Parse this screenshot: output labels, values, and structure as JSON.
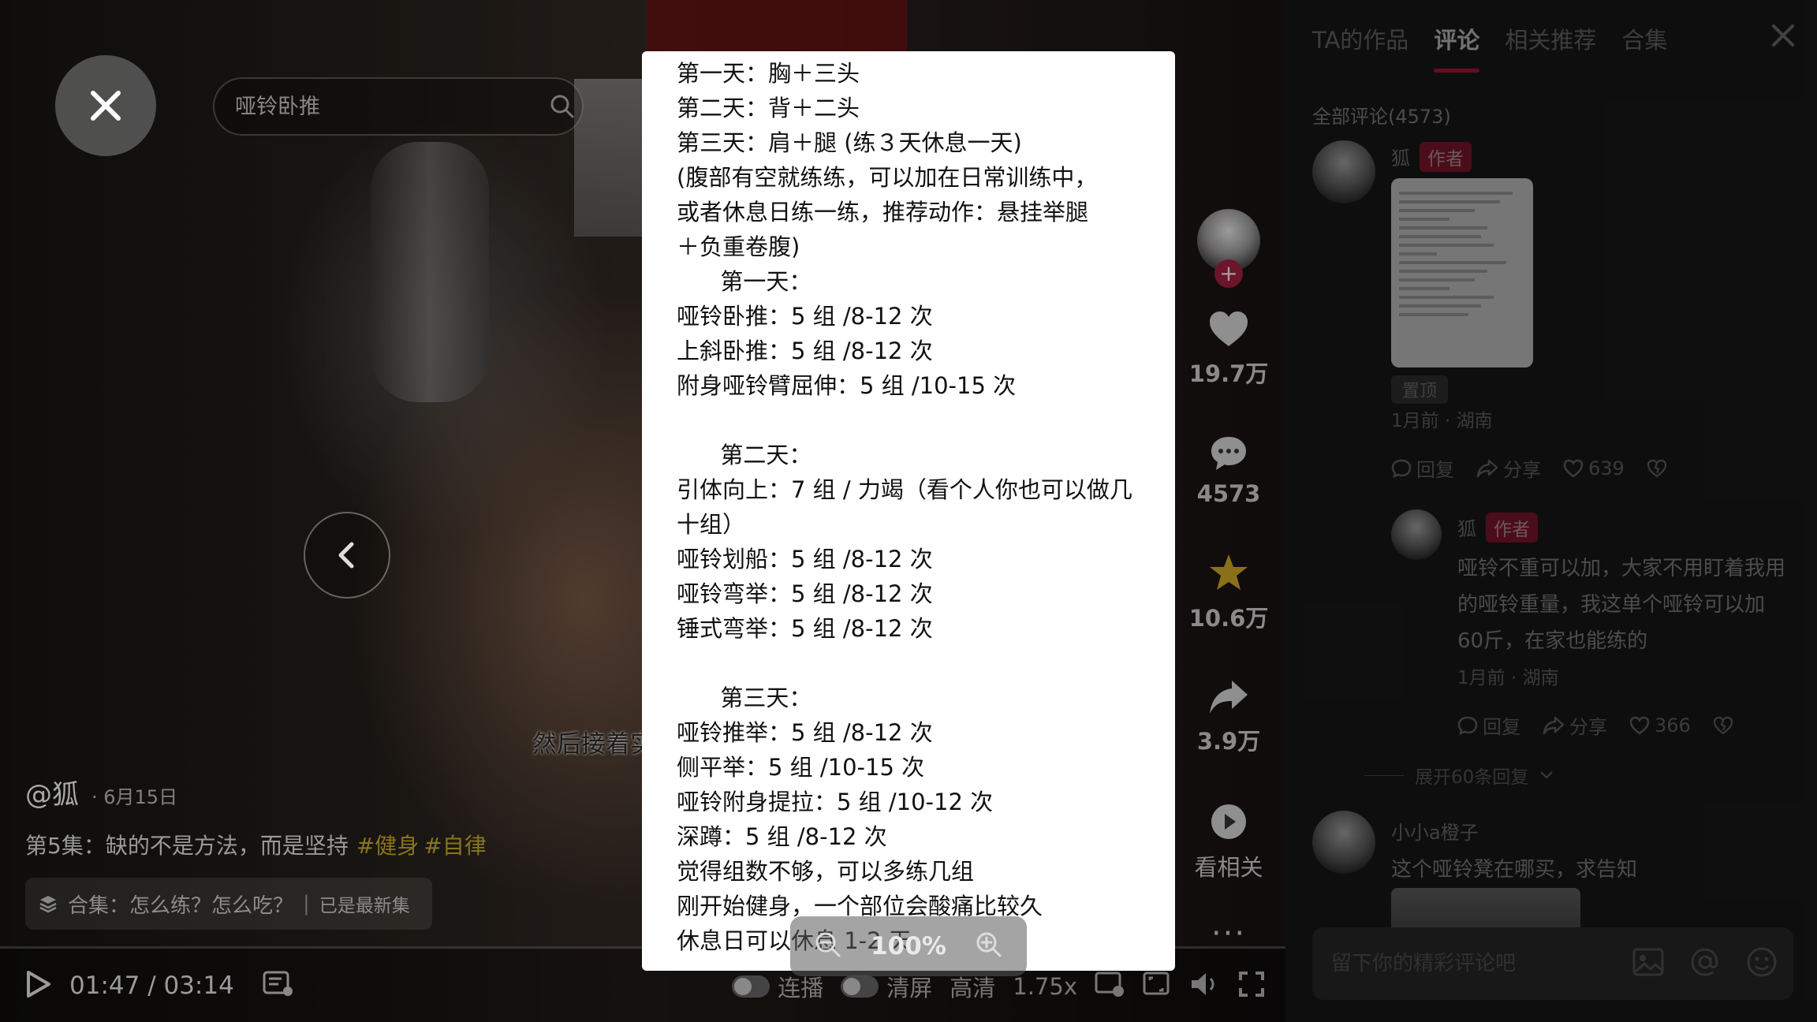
{
  "search": {
    "placeholder": "哑铃卧推"
  },
  "video": {
    "subtitle": "然后接着实",
    "author": "@狐",
    "date": "6月15日",
    "caption": "第5集：缺的不是方法，而是坚持",
    "tags": [
      "#健身",
      "#自律"
    ],
    "collection_label": "合集：怎么练？怎么吃？",
    "collection_status": "已是最新集"
  },
  "actions": {
    "likes": "19.7万",
    "comments": "4573",
    "favorites": "10.6万",
    "shares": "3.9万",
    "related": "看相关",
    "more": "···"
  },
  "player": {
    "time": "01:47 / 03:14",
    "autoplay_label": "连播",
    "clear_label": "清屏",
    "quality": "高清",
    "speed": "1.75x"
  },
  "panel": {
    "tabs": [
      "TA的作品",
      "评论",
      "相关推荐",
      "合集"
    ],
    "comment_count": "全部评论(4573)",
    "comments": [
      {
        "name": "狐",
        "author_tag": "作者",
        "pin": "置顶",
        "meta": "1月前 · 湖南",
        "reply": "回复",
        "share": "分享",
        "likes": "639"
      },
      {
        "name": "狐",
        "author_tag": "作者",
        "text": "哑铃不重可以加，大家不用盯着我用的哑铃重量，我这单个哑铃可以加60斤，在家也能练的",
        "meta": "1月前 · 湖南",
        "reply": "回复",
        "share": "分享",
        "likes": "366"
      },
      {
        "name": "小小a橙子",
        "text": "这个哑铃凳在哪买，求告知"
      }
    ],
    "expand_replies": "展开60条回复",
    "input_placeholder": "留下你的精彩评论吧"
  },
  "viewer": {
    "lines": [
      "第一天：胸＋三头",
      "第二天：背＋二头",
      "第三天：肩＋腿 (练３天休息一天)",
      "(腹部有空就练练，可以加在日常训练中，",
      "或者休息日练一练，推荐动作：悬挂举腿",
      "＋负重卷腹)",
      "      第一天：",
      "哑铃卧推：5 组 /8-12 次",
      "上斜卧推：5 组 /8-12 次",
      "附身哑铃臂屈伸：5 组 /10-15 次",
      "",
      "      第二天：",
      "引体向上：7 组 / 力竭（看个人你也可以做几",
      "十组）",
      "哑铃划船：5 组 /8-12 次",
      "哑铃弯举：5 组 /8-12 次",
      "锤式弯举：5 组 /8-12 次",
      "",
      "      第三天：",
      "哑铃推举：5 组 /8-12 次",
      "侧平举：5 组 /10-15 次",
      "哑铃附身提拉：5 组 /10-12 次",
      "深蹲：5 组 /8-12 次",
      "觉得组数不够，可以多练几组",
      "刚开始健身，一个部位会酸痛比较久",
      "休息日可以休息 1-2 天"
    ],
    "zoom": "100%"
  },
  "colors": {
    "accent": "#c2163f",
    "tag": "#8a7420",
    "author_badge": "#8a1832"
  }
}
